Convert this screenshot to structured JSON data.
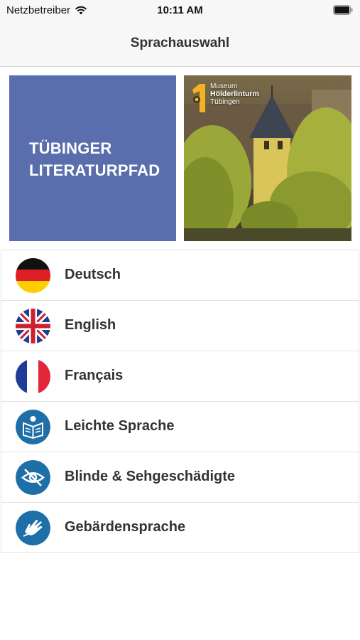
{
  "status_bar": {
    "carrier": "Netzbetreiber",
    "time": "10:11 AM"
  },
  "nav": {
    "title": "Sprachauswahl"
  },
  "banner": {
    "title_line1": "TÜBINGER",
    "title_line2": "LITERATURPFAD",
    "tile_color": "#5a6ead",
    "museum_line1": "Museum",
    "museum_line2": "Hölderlinturm",
    "museum_line3": "Tübingen"
  },
  "languages": [
    {
      "label": "Deutsch",
      "icon": "german-flag-icon"
    },
    {
      "label": "English",
      "icon": "uk-flag-icon"
    },
    {
      "label": "Français",
      "icon": "french-flag-icon"
    },
    {
      "label": "Leichte Sprache",
      "icon": "easy-language-icon"
    },
    {
      "label": "Blinde & Sehgeschädigte",
      "icon": "visually-impaired-icon"
    },
    {
      "label": "Gebärdensprache",
      "icon": "sign-language-icon"
    }
  ],
  "colors": {
    "accessibility_blue": "#1e6fa8",
    "banner_blue": "#5a6ead"
  }
}
